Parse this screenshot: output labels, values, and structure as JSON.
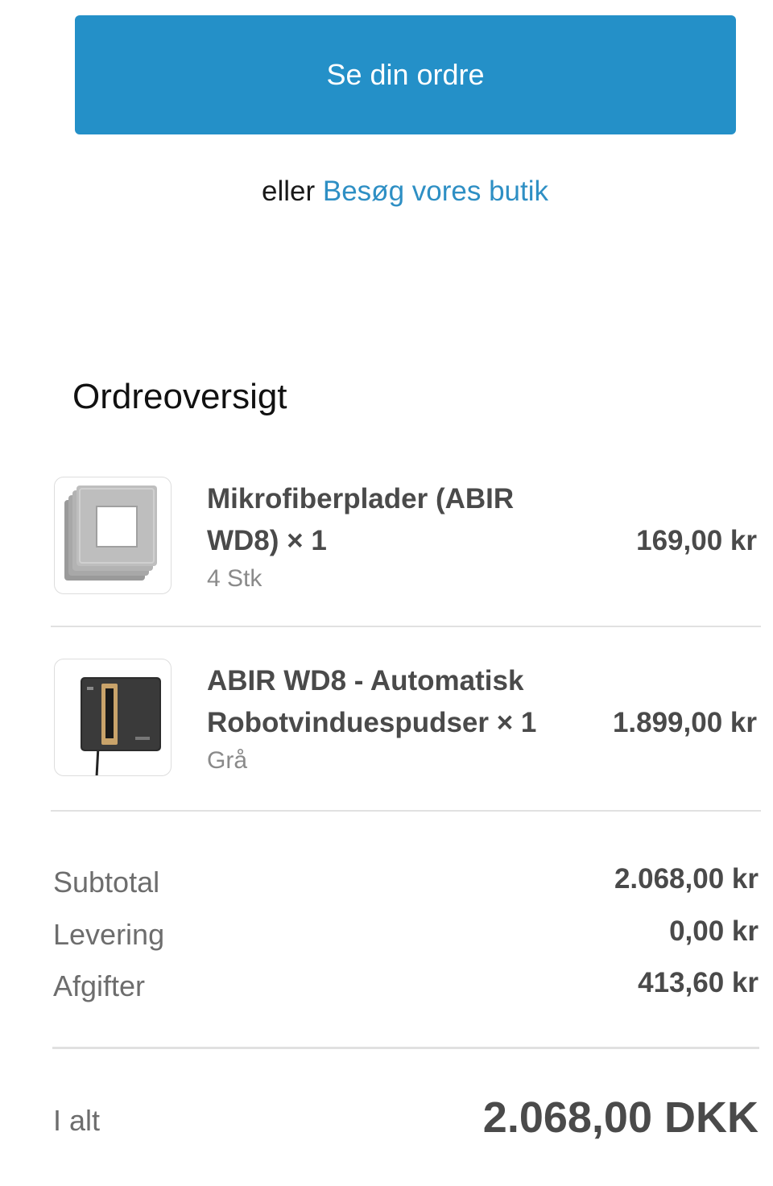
{
  "cta": {
    "label": "Se din ordre"
  },
  "alternative": {
    "prefix": "eller ",
    "link_label": "Besøg vores butik"
  },
  "summary_title": "Ordreoversigt",
  "items": [
    {
      "name_line1": "Mikrofiberplader (ABIR",
      "name_line2": "WD8) × 1",
      "variant": "4 Stk",
      "price": "169,00 kr",
      "icon": "microfiber-pads-image"
    },
    {
      "name_line1": "ABIR WD8 - Automatisk",
      "name_line2": "Robotvinduespudser × 1",
      "variant": "Grå",
      "price": "1.899,00 kr",
      "icon": "window-robot-image"
    }
  ],
  "totals": {
    "subtotal_label": "Subtotal",
    "subtotal_value": "2.068,00 kr",
    "shipping_label": "Levering",
    "shipping_value": "0,00 kr",
    "taxes_label": "Afgifter",
    "taxes_value": "413,60 kr",
    "total_label": "I alt",
    "total_value": "2.068,00 DKK"
  },
  "colors": {
    "button": "#2490c8",
    "link": "#2e8fc4"
  }
}
